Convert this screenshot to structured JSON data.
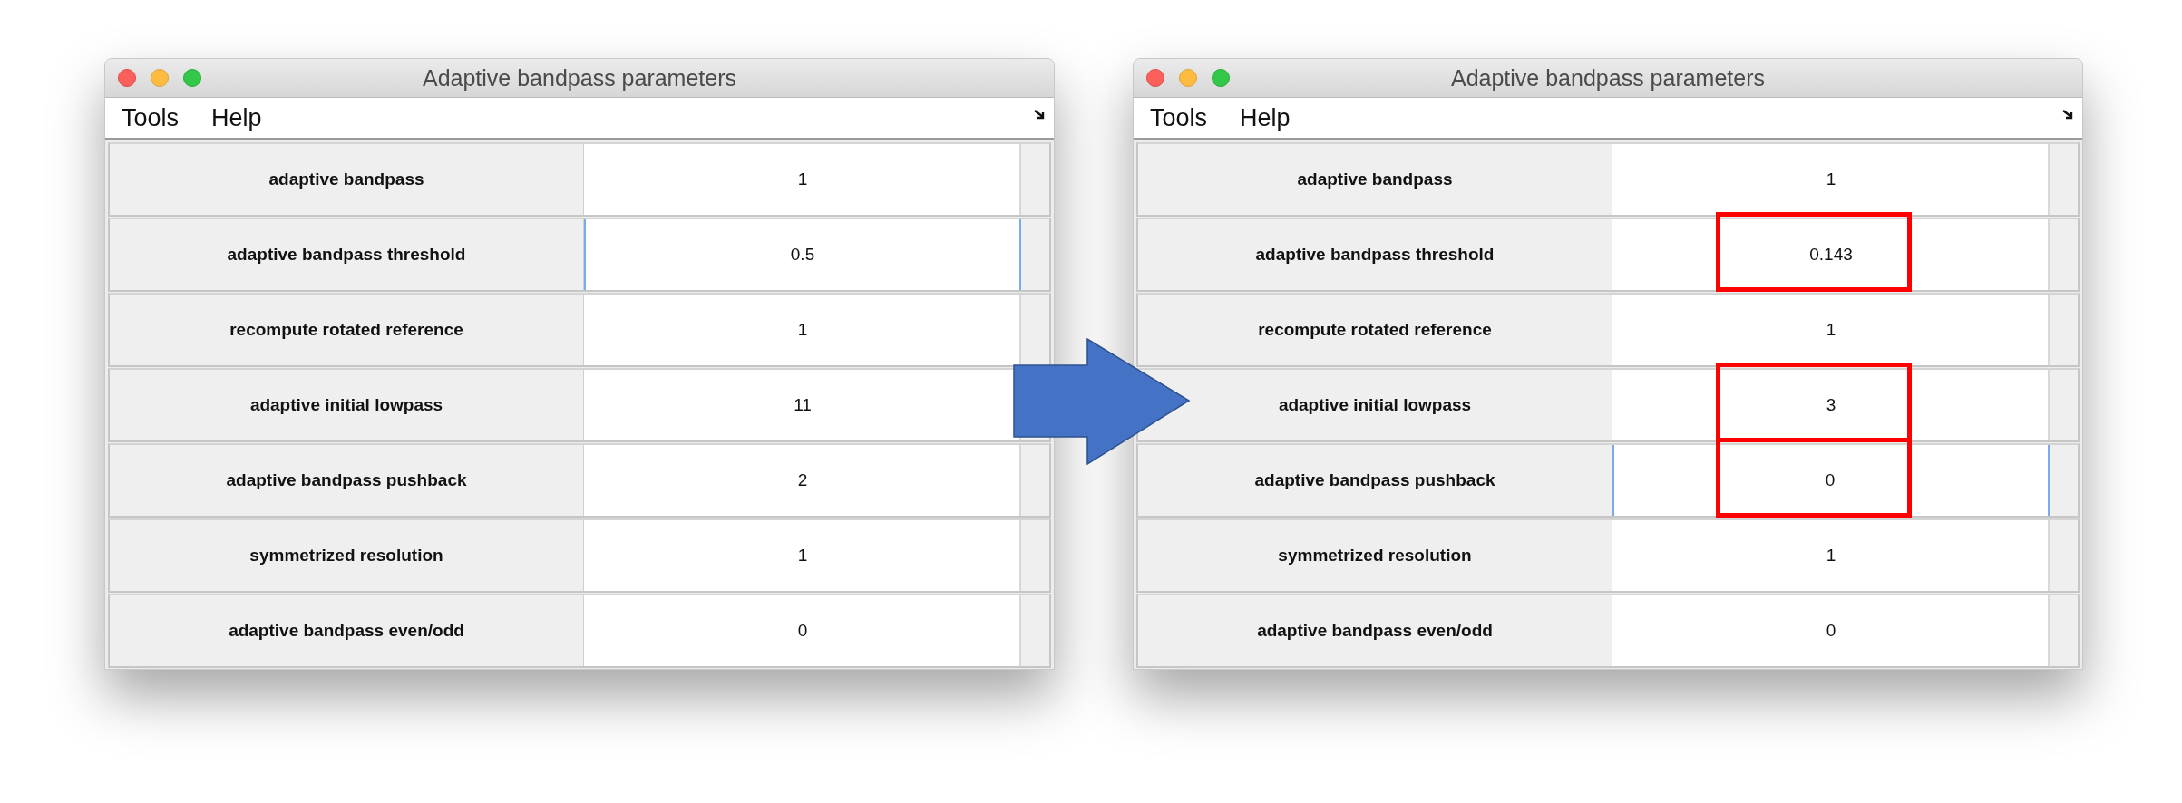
{
  "windows": [
    {
      "title": "Adaptive bandpass parameters",
      "menu": [
        "Tools",
        "Help"
      ],
      "rows": [
        {
          "label": "adaptive bandpass",
          "value": "1",
          "focused": false,
          "highlighted": false
        },
        {
          "label": "adaptive bandpass threshold",
          "value": "0.5",
          "focused": true,
          "highlighted": false
        },
        {
          "label": "recompute rotated reference",
          "value": "1",
          "focused": false,
          "highlighted": false
        },
        {
          "label": "adaptive initial lowpass",
          "value": "11",
          "focused": false,
          "highlighted": false
        },
        {
          "label": "adaptive bandpass pushback",
          "value": "2",
          "focused": false,
          "highlighted": false
        },
        {
          "label": "symmetrized resolution",
          "value": "1",
          "focused": false,
          "highlighted": false
        },
        {
          "label": "adaptive bandpass even/odd",
          "value": "0",
          "focused": false,
          "highlighted": false
        }
      ]
    },
    {
      "title": "Adaptive bandpass parameters",
      "menu": [
        "Tools",
        "Help"
      ],
      "rows": [
        {
          "label": "adaptive bandpass",
          "value": "1",
          "focused": false,
          "highlighted": false
        },
        {
          "label": "adaptive bandpass threshold",
          "value": "0.143",
          "focused": false,
          "highlighted": true
        },
        {
          "label": "recompute rotated reference",
          "value": "1",
          "focused": false,
          "highlighted": false
        },
        {
          "label": "adaptive initial lowpass",
          "value": "3",
          "focused": false,
          "highlighted": true
        },
        {
          "label": "adaptive bandpass pushback",
          "value": "0",
          "focused": true,
          "highlighted": true
        },
        {
          "label": "symmetrized resolution",
          "value": "1",
          "focused": false,
          "highlighted": false
        },
        {
          "label": "adaptive bandpass even/odd",
          "value": "0",
          "focused": false,
          "highlighted": false
        }
      ]
    }
  ]
}
